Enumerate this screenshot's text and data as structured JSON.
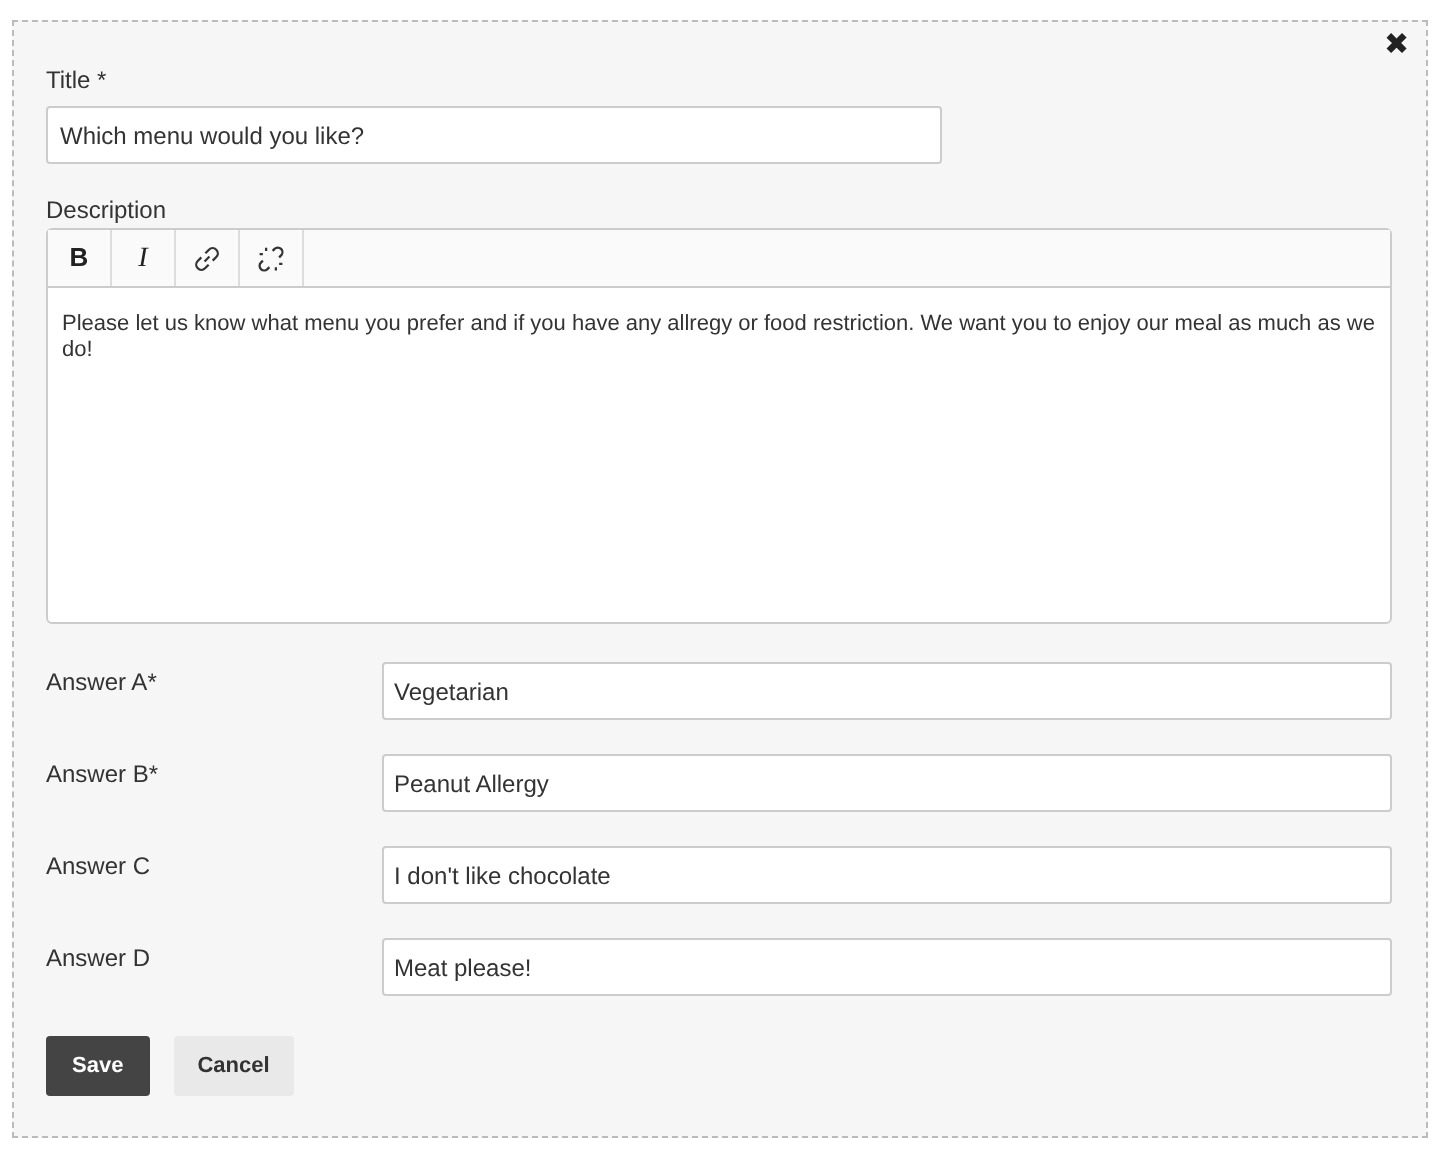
{
  "close": "✖",
  "title_field": {
    "label": "Title *",
    "value": "Which menu would you like?"
  },
  "description": {
    "label": "Description",
    "toolbar": [
      {
        "kind": "bold",
        "label": "B"
      },
      {
        "kind": "italic",
        "label": "I"
      },
      {
        "kind": "link"
      },
      {
        "kind": "unlink"
      }
    ],
    "text": "Please let us know what menu you prefer and if you have any allregy or food restriction. We want you to enjoy our meal as much as we do!"
  },
  "answers": [
    {
      "label": "Answer A*",
      "value": "Vegetarian"
    },
    {
      "label": "Answer B*",
      "value": "Peanut Allergy"
    },
    {
      "label": "Answer C",
      "value": "I don't like chocolate"
    },
    {
      "label": "Answer D",
      "value": "Meat please!"
    }
  ],
  "buttons": [
    {
      "label": "Save",
      "kind": "primary"
    },
    {
      "label": "Cancel",
      "kind": "secondary"
    }
  ]
}
